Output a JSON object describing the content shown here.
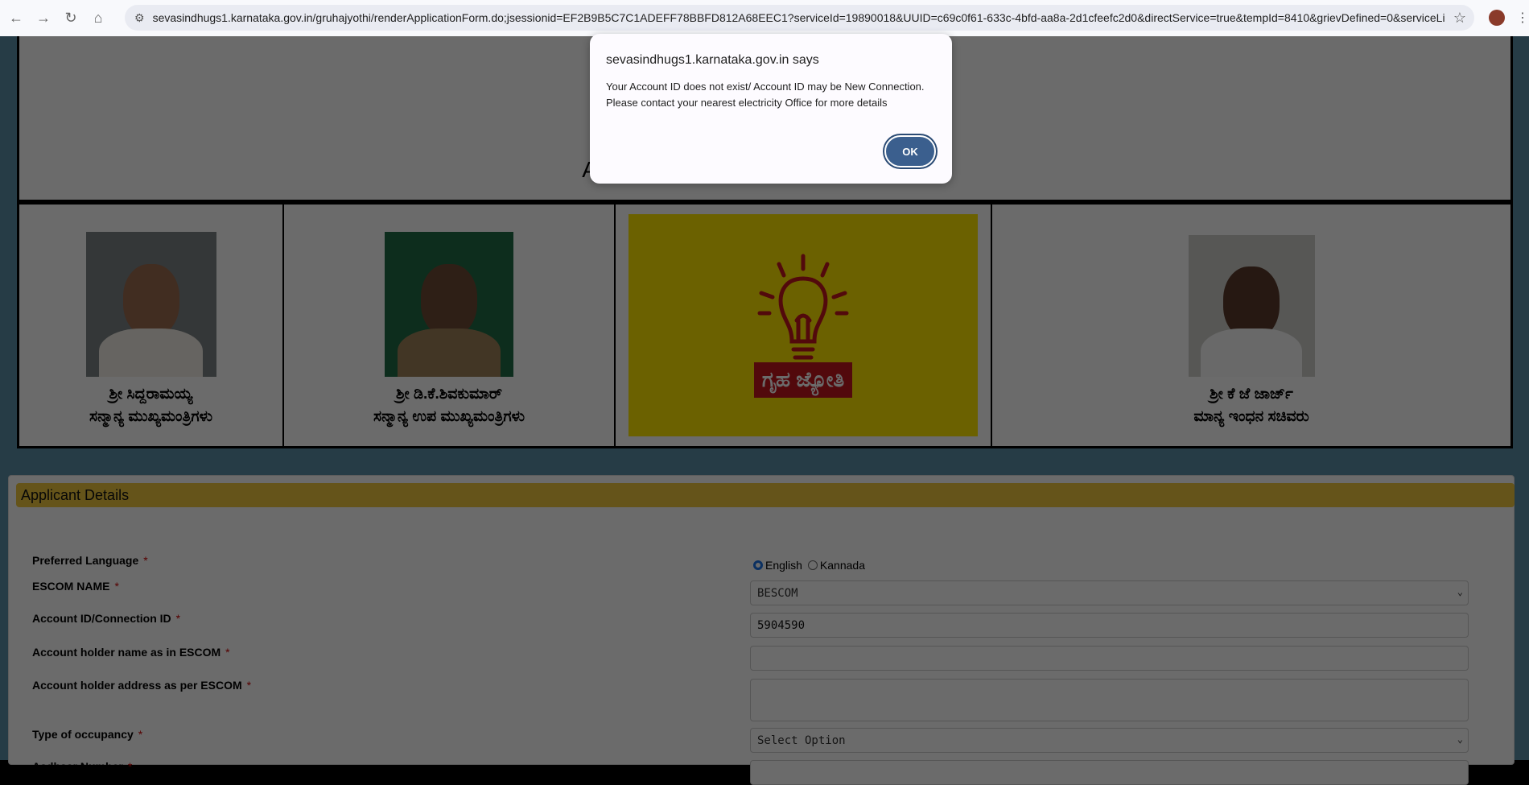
{
  "browser": {
    "url": "sevasindhugs1.karnataka.gov.in/gruhajyothi/renderApplicationForm.do;jsessionid=EF2B9B5C7C1ADEFF78BBFD812A68EEC1?serviceId=19890018&UUID=c69c0f61-633c-4bfd-aa8a-2d1cfeefc2d0&directService=true&tempId=8410&grievDefined=0&serviceLin..."
  },
  "header": {
    "title": "“ಗೃಹ ಜ್ಯೋತಿ” ಯೋಜನೆ ಅರ್ಜಿ",
    "subtitle": "Application for Gruha Jyothi Scheme"
  },
  "leaders": [
    {
      "name": "ಶ್ರೀ ಸಿದ್ದರಾಮಯ್ಯ",
      "role": "ಸನ್ಮಾನ್ಯ ಮುಖ್ಯಮಂತ್ರಿಗಳು"
    },
    {
      "name": "ಶ್ರೀ ಡಿ.ಕೆ.ಶಿವಕುಮಾರ್",
      "role": "ಸನ್ಮಾನ್ಯ ಉಪ ಮುಖ್ಯಮಂತ್ರಿಗಳು"
    },
    {
      "name": "ಶ್ರೀ ಕೆ ಜೆ ಜಾರ್ಜ್",
      "role": "ಮಾನ್ಯ ಇಂಧನ ಸಚಿವರು"
    }
  ],
  "logo": {
    "label": "ಗೃಹ ಜ್ಯೋತಿ"
  },
  "form": {
    "section_title": "Applicant Details",
    "required_mark": "*",
    "preferred_language": {
      "label": "Preferred Language",
      "options": [
        "English",
        "Kannada"
      ],
      "selected": "English"
    },
    "escom": {
      "label": "ESCOM NAME",
      "value": "BESCOM"
    },
    "account_id": {
      "label": "Account ID/Connection ID",
      "value": "5904590"
    },
    "holder_name": {
      "label": "Account holder name as in ESCOM",
      "value": ""
    },
    "holder_address": {
      "label": "Account holder address as per ESCOM",
      "value": ""
    },
    "occupancy": {
      "label": "Type of occupancy",
      "value": "Select Option"
    },
    "aadhaar": {
      "label": "Aadhaar Number",
      "value": ""
    }
  },
  "dialog": {
    "title": "sevasindhugs1.karnataka.gov.in says",
    "message_line1": "Your Account ID does not exist/ Account ID may be New Connection.",
    "message_line2": "Please contact your nearest electricity Office for more details",
    "ok_label": "OK"
  },
  "colors": {
    "section": "#f0c93e",
    "ok_button": "#3b5f8e",
    "logo_bg": "#ffe600",
    "logo_red": "#c4161c"
  }
}
